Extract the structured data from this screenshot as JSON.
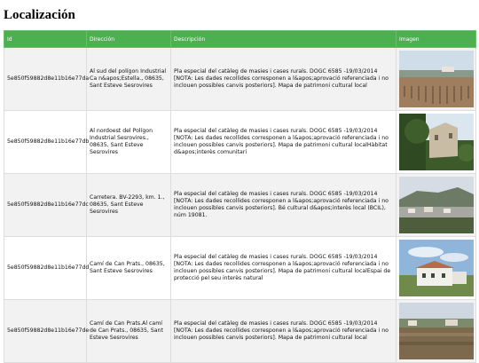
{
  "page": {
    "title": "Localización"
  },
  "table": {
    "headers": {
      "id": "Id",
      "direccion": "Dirección",
      "descripcion": "Descripción",
      "imagen": "Imagen"
    },
    "rows": [
      {
        "id": "5e850f59882d8e11b16e77da",
        "direccion": "Al sud del polígon Industrial Ca n&apos;Estella., 08635, Sant Esteve Sesrovires",
        "descripcion": "Pla especial del catàleg de masies i cases rurals. DOGC 6585 -19/03/2014 [NOTA: Les dades recollides corresponen a l&apos;aprovació referenciada i no inclouen possibles canvis posteriors]. Mapa de patrimoni cultural local",
        "image": "vineyard-photo"
      },
      {
        "id": "5e850f59882d8e11b16e77db",
        "direccion": "Al nordoest del Polígon Industrial Sesrovires., 08635, Sant Esteve Sesrovires",
        "descripcion": "Pla especial del catàleg de masies i cases rurals. DOGC 6585 -19/03/2014 [NOTA: Les dades recollides corresponen a l&apos;aprovació referenciada i no inclouen possibles canvis posteriors]. Mapa de patrimoni cultural localHàbitat d&apos;interès comunitari",
        "image": "ruined-tower-photo"
      },
      {
        "id": "5e850f59882d8e11b16e77dc",
        "direccion": "Carretera. BV-2293, km. 1., 08635, Sant Esteve Sesrovires",
        "descripcion": "Pla especial del catàleg de masies i cases rurals. DOGC 6585 -19/03/2014 [NOTA: Les dades recollides corresponen a l&apos;aprovació referenciada i no inclouen possibles canvis posteriors]. Bé cultural d&apos;interès local (BCIL), núm 19081.",
        "image": "hillside-village-photo"
      },
      {
        "id": "5e850f59882d8e11b16e77dd",
        "direccion": "Camí de Can Prats., 08635, Sant Esteve Sesrovires",
        "descripcion": "Pla especial del catàleg de masies i cases rurals. DOGC 6585 -19/03/2014 [NOTA: Les dades recollides corresponen a l&apos;aprovació referenciada i no inclouen possibles canvis posteriors]. Mapa de patrimoni cultural localEspai de protecció pel seu interès natural",
        "image": "white-farmhouse-photo"
      },
      {
        "id": "5e850f59882d8e11b16e77de",
        "direccion": "Camí de Can Prats.Al camí de Can Prats., 08635, Sant Esteve Sesrovires",
        "descripcion": "Pla especial del catàleg de masies i cases rurals. DOGC 6585 -19/03/2014 [NOTA: Les dades recollides corresponen a l&apos;aprovació referenciada i no inclouen possibles canvis posteriors]. Mapa de patrimoni cultural local",
        "image": "field-houses-photo"
      }
    ]
  }
}
